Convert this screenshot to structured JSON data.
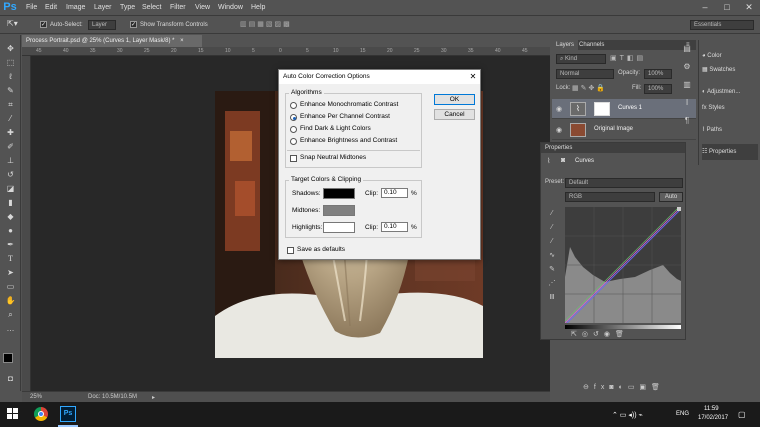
{
  "app": {
    "logo": "Ps",
    "accent": "#31a8ff"
  },
  "menu": [
    "File",
    "Edit",
    "Image",
    "Layer",
    "Type",
    "Select",
    "Filter",
    "View",
    "Window",
    "Help"
  ],
  "options_bar": {
    "auto_select_label": "Auto-Select:",
    "auto_select_value": "Layer",
    "transform_label": "Show Transform Controls",
    "workspace": "Essentials"
  },
  "document": {
    "tab_title": "Process Portrait.psd @ 25% (Curves 1, Layer Mask/8) *",
    "zoom": "25%",
    "doc_size": "Doc: 10.5M/10.5M"
  },
  "ruler_h": [
    "45",
    "40",
    "35",
    "30",
    "25",
    "20",
    "15",
    "10",
    "5",
    "0",
    "5",
    "10",
    "15",
    "20",
    "25",
    "30",
    "35",
    "40",
    "45"
  ],
  "layers_panel": {
    "tabs": [
      "Layers",
      "Channels"
    ],
    "filter": "Kind",
    "blend_mode": "Normal",
    "opacity_label": "Opacity:",
    "opacity_value": "100%",
    "lock_label": "Lock:",
    "fill_label": "Fill:",
    "fill_value": "100%",
    "layers": [
      {
        "name": "Curves 1",
        "selected": true
      },
      {
        "name": "Original Image",
        "selected": false
      }
    ]
  },
  "right_dock": [
    {
      "label": "Color",
      "icon": "color-icon"
    },
    {
      "label": "Swatches",
      "icon": "swatches-icon"
    },
    {
      "label": "Adjustmen...",
      "icon": "adjustments-icon"
    },
    {
      "label": "Styles",
      "icon": "styles-icon"
    },
    {
      "label": "Paths",
      "icon": "paths-icon"
    },
    {
      "label": "Properties",
      "icon": "properties-icon"
    }
  ],
  "properties_panel": {
    "title": "Properties",
    "adjustment": "Curves",
    "preset_label": "Preset:",
    "preset_value": "Default",
    "channel": "RGB",
    "auto_button": "Auto"
  },
  "dialog": {
    "title": "Auto Color Correction Options",
    "algorithms_label": "Algorithms",
    "algorithms": [
      {
        "label": "Enhance Monochromatic Contrast",
        "selected": false
      },
      {
        "label": "Enhance Per Channel Contrast",
        "selected": true
      },
      {
        "label": "Find Dark & Light Colors",
        "selected": false
      },
      {
        "label": "Enhance Brightness and Contrast",
        "selected": false
      }
    ],
    "snap_label": "Snap Neutral Midtones",
    "targets_label": "Target Colors & Clipping",
    "shadows_label": "Shadows:",
    "midtones_label": "Midtones:",
    "highlights_label": "Highlights:",
    "clip_label": "Clip:",
    "shadows_clip": "0.10",
    "highlights_clip": "0.10",
    "percent": "%",
    "shadow_color": "#000000",
    "midtone_color": "#808080",
    "highlight_color": "#ffffff",
    "save_defaults_label": "Save as defaults",
    "ok_label": "OK",
    "cancel_label": "Cancel"
  },
  "taskbar": {
    "lang": "ENG",
    "time": "11:59",
    "date": "17/02/2017"
  }
}
